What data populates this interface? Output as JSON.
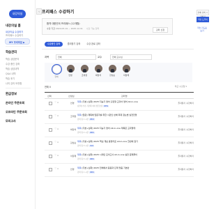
{
  "sidebar": {
    "brand": "내강의실",
    "sections": [
      {
        "title": "내강의실 홈"
      },
      {
        "title": "학습관리"
      },
      {
        "title": "환급정보"
      },
      {
        "title": "모의고사"
      }
    ],
    "items_top": [
      "내강의실 수강하기",
      "프리패스 수강하기"
    ],
    "freepass_pill": "MY 프리미엄 ▶",
    "items_study": [
      "학습 상담문의",
      "수강 중인 강좌",
      "학습 상담내역",
      "Q&A 내역",
      "학습 후기",
      "나의 강의 보관함"
    ],
    "items_etc": [
      "온라인 주문조회",
      "오프라인 주문조회",
      "모의고사"
    ]
  },
  "main": {
    "page_title": "프리패스 수강하기",
    "back": "‹",
    "course": {
      "line1": "합격 대한민국 프리패스 (12개월)",
      "line2_label": "수강 기간",
      "line2_value": "2024.05.19 ~ 2025.12.31",
      "line2_extra": "수강 가능 강좌",
      "button": "강좌 신청"
    },
    "tabs": [
      "수강중인 강좌",
      "즐겨찾기 강좌",
      "수강 완료 강좌"
    ],
    "filter": {
      "label": "과목",
      "select": "전체",
      "label2": "교수",
      "select2": "전체 교수님"
    },
    "teachers": [
      {
        "name": "전체"
      },
      {
        "name": "안영"
      },
      {
        "name": "조태정"
      },
      {
        "name": "박정석"
      },
      {
        "name": "강남순"
      },
      {
        "name": "이정제"
      }
    ],
    "list_count": "전체 0",
    "sort_label": "최근 수강일 ▾",
    "table_headers": [
      "선택",
      "선생님",
      "강좌명",
      "",
      ""
    ],
    "rows": [
      {
        "teacher": "안영",
        "tag": "제목",
        "title": "[기본+심화] 2025 지능기 영어 출판형 교과서 영어 All-in-one",
        "sub": "[강좌] 수강 기간제 이어 성립보장",
        "badge": "NEW",
        "btn1": "즐겨찾기",
        "btn2": "수강하기"
      },
      {
        "teacher": "조태정",
        "tag": "제목",
        "title": "[입문] 제목에 입문자를 위한 사관인 반배 최대 잡는법 실전전망",
        "sub": "강좌 총 1 시간",
        "badge": "BEST",
        "btn1": "즐겨찾기",
        "btn2": "수강하기"
      },
      {
        "teacher": "박정석",
        "tag": "제목",
        "title": "[기본+심화] 2025 지능기 영어 All-in-one 제목은 교과형태",
        "sub": "강좌 총 2 시간",
        "badge": "NEW",
        "btn1": "즐겨찾기",
        "btn2": "수강하기"
      },
      {
        "teacher": "강남순",
        "tag": "제목",
        "title": "[기본+심화] 2025 핵심 개념 총정리로 All-in-one 한번에 잡기",
        "sub": "강좌 총 3 시간",
        "badge": "HOT",
        "btn1": "즐겨찾기",
        "btn2": "수강하기"
      },
      {
        "teacher": "이정제",
        "tag": "제목",
        "title": "[기본+심화] 2025 시대인 모의고사 All-in-one 실전 문제풀이",
        "sub": "강좌 총 3 시간",
        "badge": "NEW",
        "btn1": "즐겨찾기",
        "btn2": "수강하기"
      },
      {
        "teacher": "안영",
        "tag": "제목",
        "title": "[기본+심화] 2025 전체에서 응용과 단계 맞춤 기본반",
        "sub": "강좌 총 1 시간",
        "badge": "NEW",
        "btn1": "즐겨찾기",
        "btn2": "수강하기"
      }
    ]
  },
  "rail": {
    "buttons": [
      "전체 강의 수강하기",
      "학습 도우미"
    ],
    "note": "학습 진도표 보기"
  },
  "colors": {
    "accent": "#2f5bd8"
  }
}
